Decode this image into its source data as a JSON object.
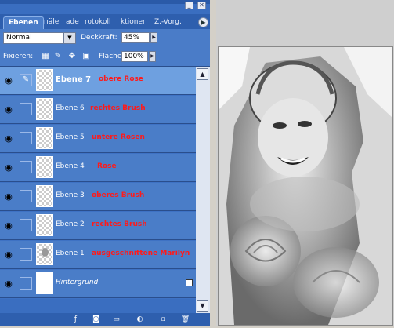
{
  "panel": {
    "tabs": [
      {
        "label": "Ebenen"
      },
      {
        "label": "näle"
      },
      {
        "label": "ade"
      },
      {
        "label": "rotokoll"
      },
      {
        "label": "ktionen"
      },
      {
        "label": "Z.-Vorg."
      }
    ],
    "blend_mode": "Normal",
    "opacity_label": "Deckkraft:",
    "opacity_value": "45%",
    "lock_label": "Fixieren:",
    "fill_label": "Fläche",
    "fill_value": "100%"
  },
  "layers": [
    {
      "name": "Ebene 7",
      "note": "obere Rose",
      "selected": true
    },
    {
      "name": "Ebene 6",
      "note": "rechtes Brush"
    },
    {
      "name": "Ebene 5",
      "note": "untere Rosen"
    },
    {
      "name": "Ebene 4",
      "note": "Rose"
    },
    {
      "name": "Ebene 3",
      "note": "oberes Brush"
    },
    {
      "name": "Ebene 2",
      "note": "rechtes Brush"
    },
    {
      "name": "Ebene 1",
      "note": "ausgeschnittene Marilyn"
    },
    {
      "name": "Hintergrund",
      "note": ""
    }
  ],
  "colors": {
    "panel": "#3a6ec0",
    "selected_row": "#6ea0e0",
    "note": "#ff1a1a"
  }
}
